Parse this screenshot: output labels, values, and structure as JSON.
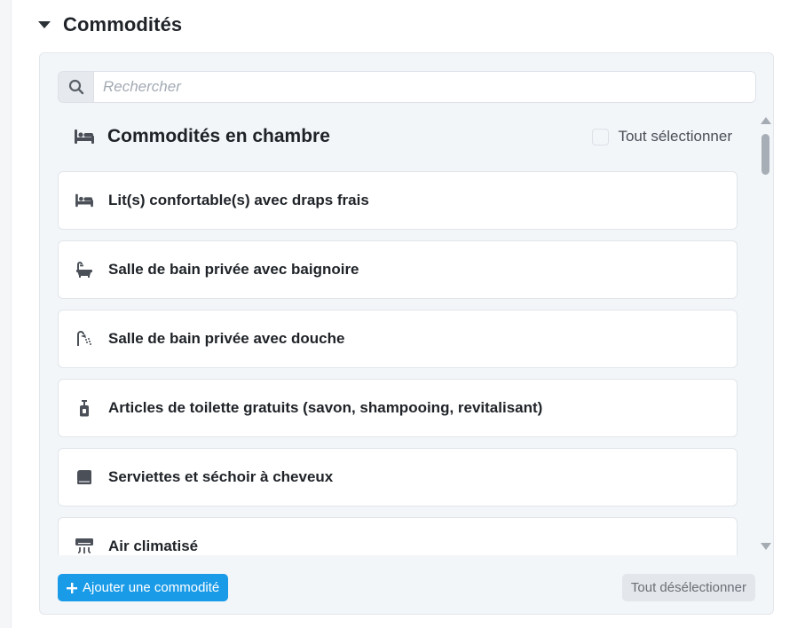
{
  "section": {
    "title": "Commodités"
  },
  "search": {
    "placeholder": "Rechercher",
    "value": ""
  },
  "category": {
    "title": "Commodités en chambre",
    "icon": "bed-icon",
    "select_all_label": "Tout sélectionner"
  },
  "items": [
    {
      "label": "Lit(s) confortable(s) avec draps frais",
      "icon": "bed-icon"
    },
    {
      "label": "Salle de bain privée avec baignoire",
      "icon": "bathtub-icon"
    },
    {
      "label": "Salle de bain privée avec douche",
      "icon": "shower-icon"
    },
    {
      "label": "Articles de toilette gratuits (savon, shampooing, revitalisant)",
      "icon": "soap-bottle-icon"
    },
    {
      "label": "Serviettes et séchoir à cheveux",
      "icon": "towel-icon"
    },
    {
      "label": "Air climatisé",
      "icon": "air-conditioner-icon"
    }
  ],
  "actions": {
    "add_label": "Ajouter une commodité",
    "deselect_label": "Tout désélectionner"
  },
  "colors": {
    "accent": "#1a9be8",
    "panel_bg": "#f3f6f9",
    "icon": "#4b5058"
  }
}
